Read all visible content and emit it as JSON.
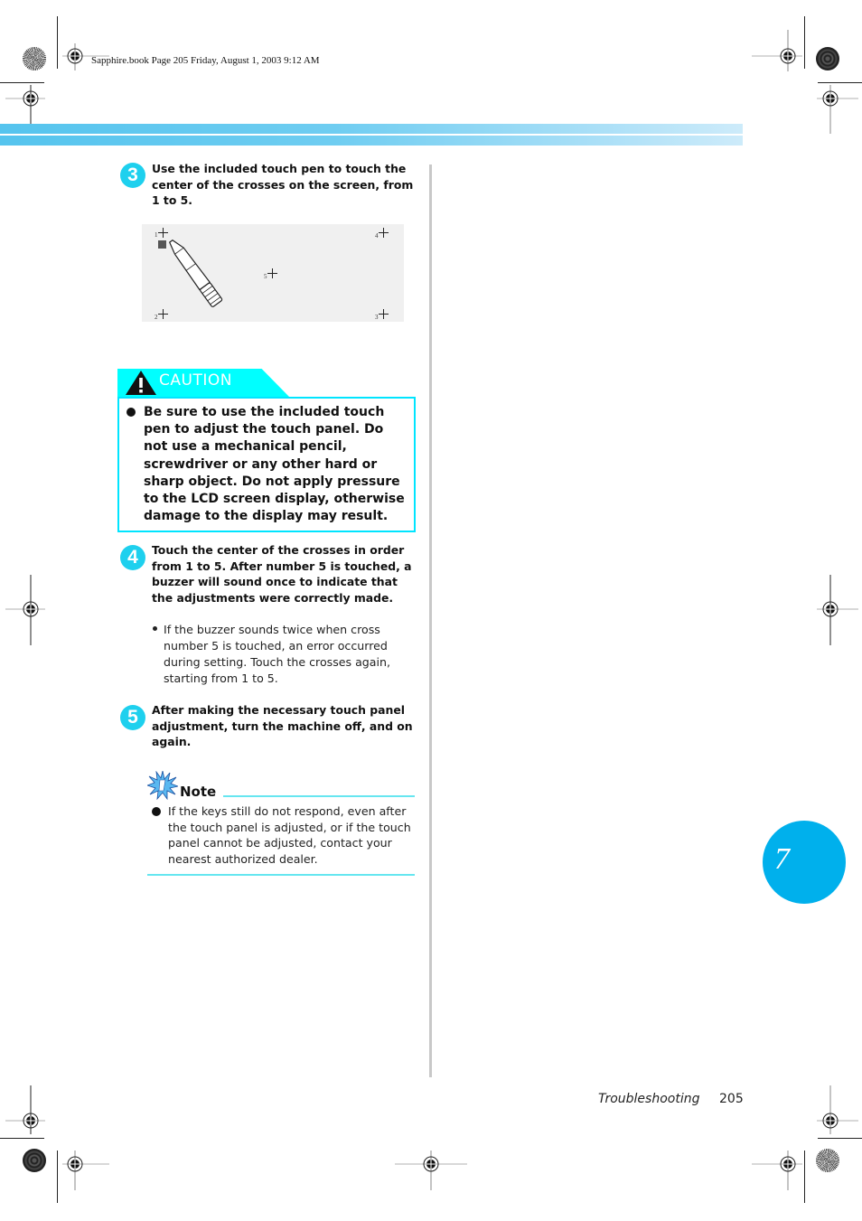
{
  "print_header": {
    "info": "Sapphire.book  Page 205  Friday, August 1, 2003  9:12 AM"
  },
  "steps": [
    {
      "number": "3",
      "text": "Use the included touch pen to touch the center of the crosses on the screen, from 1 to 5."
    },
    {
      "number": "4",
      "text": "Touch the center of the crosses in order from 1 to 5. After number 5 is touched, a buzzer will sound once to indicate that the adjustments were correctly made."
    },
    {
      "number": "5",
      "text": "After making the necessary touch panel adjustment, turn the machine off, and on again."
    }
  ],
  "illustration": {
    "crosses": [
      {
        "label": "1"
      },
      {
        "label": "2"
      },
      {
        "label": "3"
      },
      {
        "label": "4"
      },
      {
        "label": "5"
      }
    ],
    "pen_icon": "touch-pen-icon"
  },
  "caution": {
    "title": "CAUTION",
    "icon": "warning-triangle-icon",
    "text": "Be sure to use the included touch pen to adjust the touch panel. Do not use a mechanical pencil, screwdriver or any other hard or sharp object. Do not apply pressure to the LCD screen display, otherwise damage to the display may result."
  },
  "step4_subnote": "If the buzzer sounds twice when cross number 5 is touched, an error occurred during setting. Touch the crosses again, starting from 1 to 5.",
  "note": {
    "title": "Note",
    "icon": "note-burst-icon",
    "text": "If the keys still do not respond, even after the touch panel is adjusted, or if the touch panel cannot be adjusted, contact your nearest authorized dealer."
  },
  "chapter_tab": {
    "number": "7"
  },
  "footer": {
    "section": "Troubleshooting",
    "page": "205"
  },
  "colors": {
    "accent_cyan": "#00ffff",
    "step_circle": "#1ed0ee",
    "chapter_blue": "#00b0ec",
    "band_blue": "#55c4ee"
  }
}
